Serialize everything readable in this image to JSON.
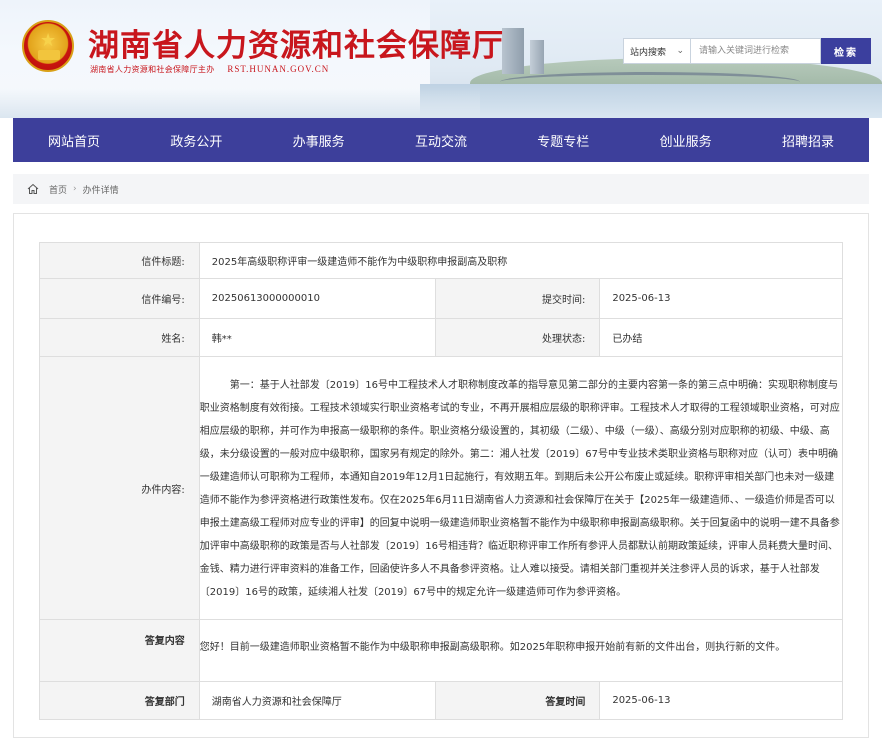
{
  "header": {
    "site_title": "湖南省人力资源和社会保障厅",
    "sponsor": "湖南省人力资源和社会保障厅主办",
    "url": "RST.HUNAN.GOV.CN"
  },
  "search": {
    "scope": "站内搜索",
    "placeholder": "请输入关键词进行检索",
    "button": "检索"
  },
  "nav": {
    "items": [
      "网站首页",
      "政务公开",
      "办事服务",
      "互动交流",
      "专题专栏",
      "创业服务",
      "招聘招录"
    ]
  },
  "breadcrumb": {
    "home": "首页",
    "current": "办件详情"
  },
  "letter": {
    "title_label": "信件标题:",
    "title_value": "2025年高级职称评审一级建造师不能作为中级职称申报副高及职称",
    "number_label": "信件编号:",
    "number_value": "20250613000000010",
    "submit_label": "提交时间:",
    "submit_value": "2025-06-13",
    "name_label": "姓名:",
    "name_value": "韩**",
    "status_label": "处理状态:",
    "status_value": "已办结",
    "content_label": "办件内容:",
    "content_value": "第一：基于人社部发〔2019〕16号中工程技术人才职称制度改革的指导意见第二部分的主要内容第一条的第三点中明确：实现职称制度与职业资格制度有效衔接。工程技术领域实行职业资格考试的专业，不再开展相应层级的职称评审。工程技术人才取得的工程领域职业资格，可对应相应层级的职称，并可作为申报高一级职称的条件。职业资格分级设置的，其初级（二级）、中级（一级）、高级分别对应职称的初级、中级、高级，未分级设置的一般对应中级职称，国家另有规定的除外。第二：湘人社发〔2019〕67号中专业技术类职业资格与职称对应（认可）表中明确一级建造师认可职称为工程师，本通知自2019年12月1日起施行，有效期五年。到期后未公开公布废止或延续。职称评审相关部门也未对一级建造师不能作为参评资格进行政策性发布。仅在2025年6月11日湖南省人力资源和社会保障厅在关于【2025年一级建造师、、一级造价师是否可以申报土建高级工程师对应专业的评审】的回复中说明一级建造师职业资格暂不能作为中级职称申报副高级职称。关于回复函中的说明一建不具备参加评审中高级职称的政策是否与人社部发〔2019〕16号相违背？临近职称评审工作所有参评人员都默认前期政策延续，评审人员耗费大量时间、金钱、精力进行评审资料的准备工作，回函使许多人不具备参评资格。让人难以接受。请相关部门重视并关注参评人员的诉求，基于人社部发〔2019〕16号的政策，延续湘人社发〔2019〕67号中的规定允许一级建造师可作为参评资格。",
    "reply_label": "答复内容",
    "reply_value": "您好！目前一级建造师职业资格暂不能作为中级职称申报副高级职称。如2025年职称申报开始前有新的文件出台，则执行新的文件。",
    "dept_label": "答复部门",
    "dept_value": "湖南省人力资源和社会保障厅",
    "reply_time_label": "答复时间",
    "reply_time_value": "2025-06-13"
  },
  "colors": {
    "brand_red": "#c8161d",
    "nav_blue": "#3d3f9b"
  }
}
